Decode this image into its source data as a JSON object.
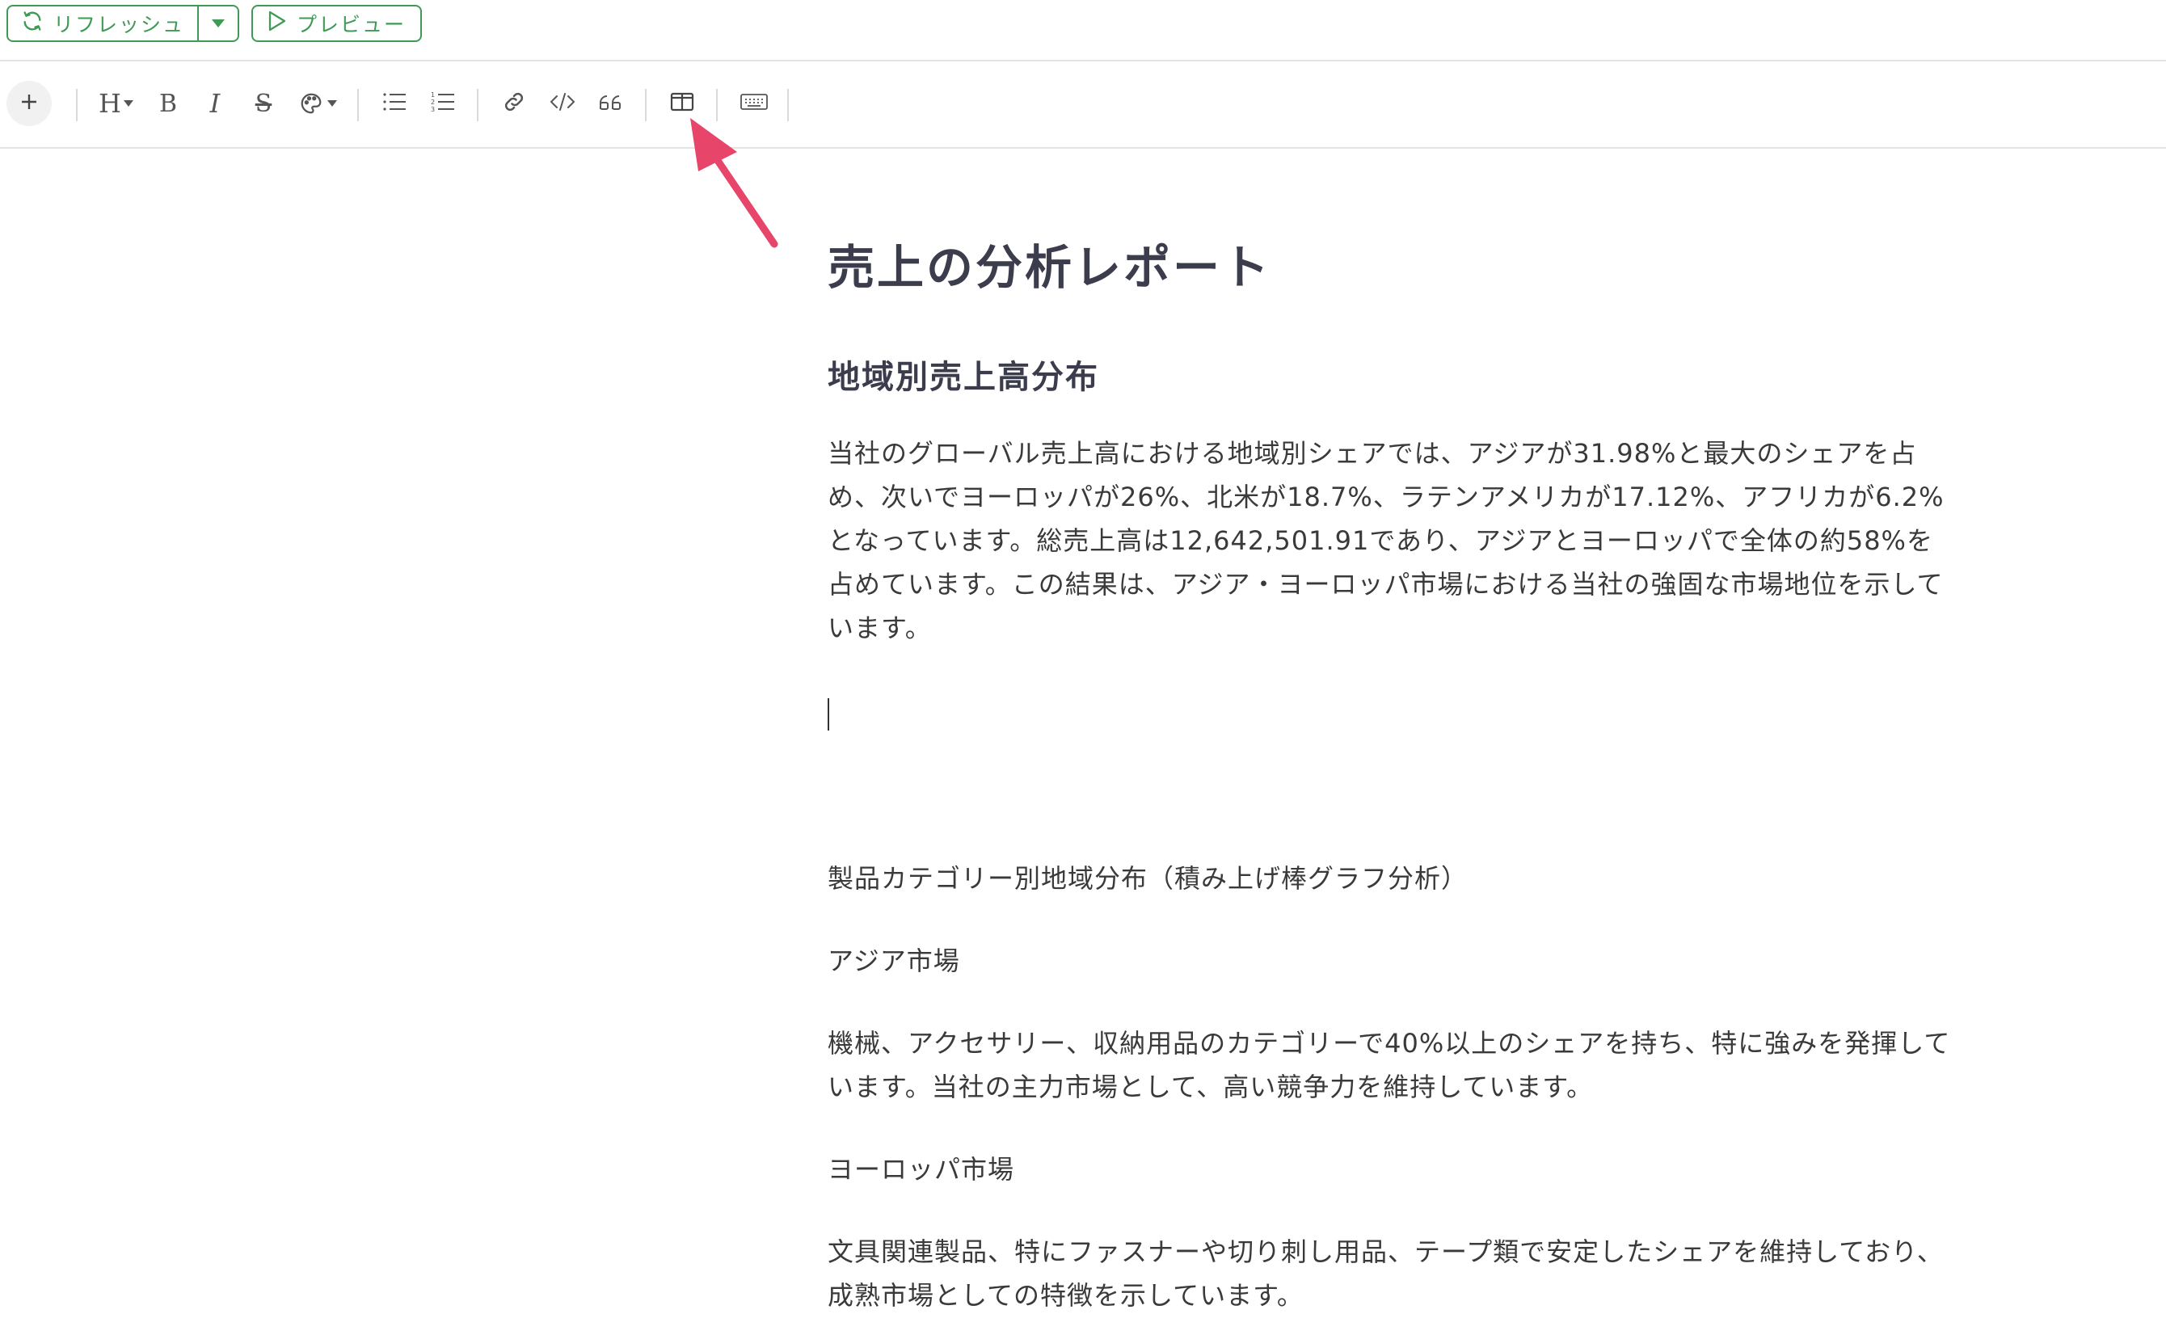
{
  "topbar": {
    "refresh_label": "リフレッシュ",
    "preview_label": "プレビュー",
    "accent_color": "#3f9a55"
  },
  "toolbar": {
    "icons": [
      "plus-icon",
      "heading-icon",
      "bold-icon",
      "italic-icon",
      "strikethrough-icon",
      "palette-icon",
      "bullet-list-icon",
      "numbered-list-icon",
      "link-icon",
      "code-icon",
      "quote-icon",
      "columns-icon",
      "keyboard-icon"
    ],
    "heading_label": "H",
    "bold_label": "B",
    "italic_label": "I",
    "strike_label": "S",
    "highlight_color": "#e8456b"
  },
  "document": {
    "title": "売上の分析レポート",
    "heading": "地域別売上高分布",
    "intro": "当社のグローバル売上高における地域別シェアでは、アジアが31.98%と最大のシェアを占め、次いでヨーロッパが26%、北米が18.7%、ラテンアメリカが17.12%、アフリカが6.2%となっています。総売上高は12,642,501.91であり、アジアとヨーロッパで全体の約58%を占めています。この結果は、アジア・ヨーロッパ市場における当社の強固な市場地位を示しています。",
    "category_section": "製品カテゴリー別地域分布（積み上げ棒グラフ分析）",
    "asia_heading": "アジア市場",
    "asia_text": "機械、アクセサリー、収納用品のカテゴリーで40%以上のシェアを持ち、特に強みを発揮しています。当社の主力市場として、高い競争力を維持しています。",
    "europe_heading": "ヨーロッパ市場",
    "europe_text": "文具関連製品、特にファスナーや切り刺し用品、テープ類で安定したシェアを維持しており、成熟市場としての特徴を示しています。"
  }
}
